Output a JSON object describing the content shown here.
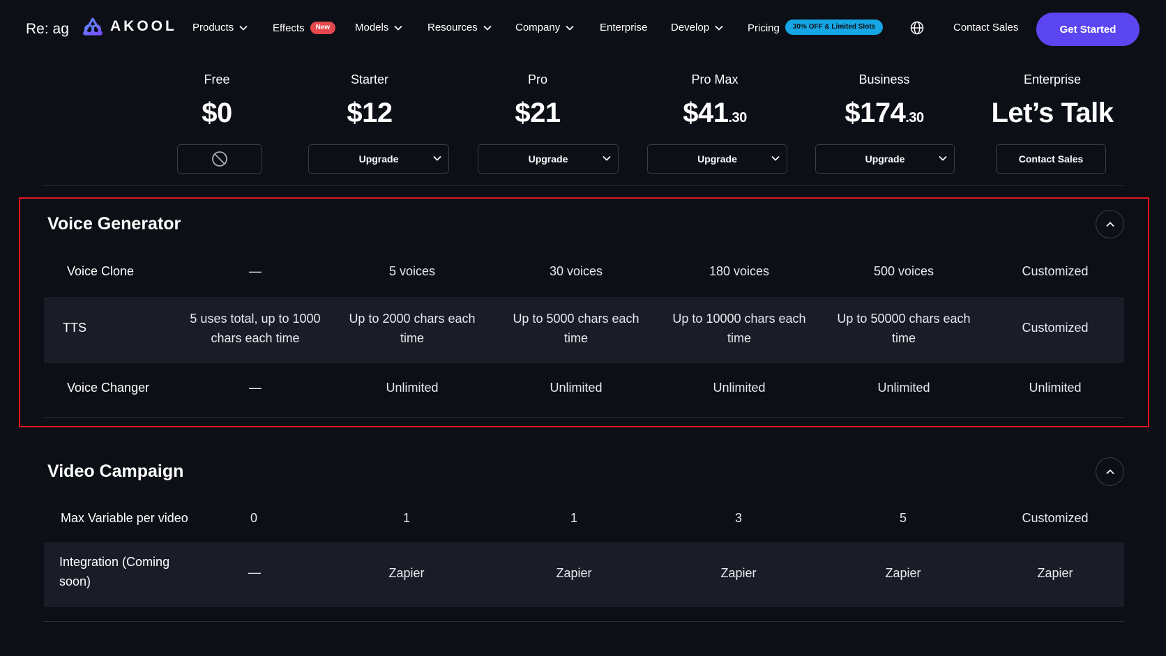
{
  "nav": {
    "reag": "Re: ag",
    "brand": "AKOOL",
    "products": "Products",
    "effects": "Effects",
    "effects_badge": "New",
    "models": "Models",
    "resources": "Resources",
    "company": "Company",
    "enterprise": "Enterprise",
    "develop": "Develop",
    "pricing": "Pricing",
    "pricing_badge": "30% OFF & Limited Slots",
    "contact_sales": "Contact Sales",
    "get_started": "Get Started",
    "accent_color": "#5b46f2"
  },
  "plans": [
    {
      "name": "Free",
      "price": "$0",
      "cents": "",
      "button": ""
    },
    {
      "name": "Starter",
      "price": "$12",
      "cents": "",
      "button": "Upgrade"
    },
    {
      "name": "Pro",
      "price": "$21",
      "cents": "",
      "button": "Upgrade"
    },
    {
      "name": "Pro Max",
      "price": "$41",
      "cents": ".30",
      "button": "Upgrade"
    },
    {
      "name": "Business",
      "price": "$174",
      "cents": ".30",
      "button": "Upgrade"
    },
    {
      "name": "Enterprise",
      "price": "Let’s Talk",
      "cents": "",
      "button": "Contact Sales"
    }
  ],
  "voice_generator": {
    "title": "Voice Generator",
    "rows": [
      {
        "label": "Voice Clone",
        "values": [
          "—",
          "5 voices",
          "30 voices",
          "180 voices",
          "500 voices",
          "Customized"
        ]
      },
      {
        "label": "TTS",
        "values": [
          [
            "5 uses total, up to 1000",
            "chars each time"
          ],
          [
            "Up to 2000 chars each",
            "time"
          ],
          [
            "Up to 5000 chars each",
            "time"
          ],
          [
            "Up to 10000 chars each",
            "time"
          ],
          [
            "Up to 50000 chars each",
            "time"
          ],
          "Customized"
        ]
      },
      {
        "label": "Voice Changer",
        "values": [
          "—",
          "Unlimited",
          "Unlimited",
          "Unlimited",
          "Unlimited",
          "Unlimited"
        ]
      }
    ]
  },
  "video_campaign": {
    "title": "Video Campaign",
    "rows": [
      {
        "label": "Max Variable per video",
        "values": [
          "0",
          "1",
          "1",
          "3",
          "5",
          "Customized"
        ]
      },
      {
        "label": [
          "Integration (Coming",
          "soon)"
        ],
        "values": [
          "—",
          "Zapier",
          "Zapier",
          "Zapier",
          "Zapier",
          "Zapier"
        ]
      }
    ]
  }
}
